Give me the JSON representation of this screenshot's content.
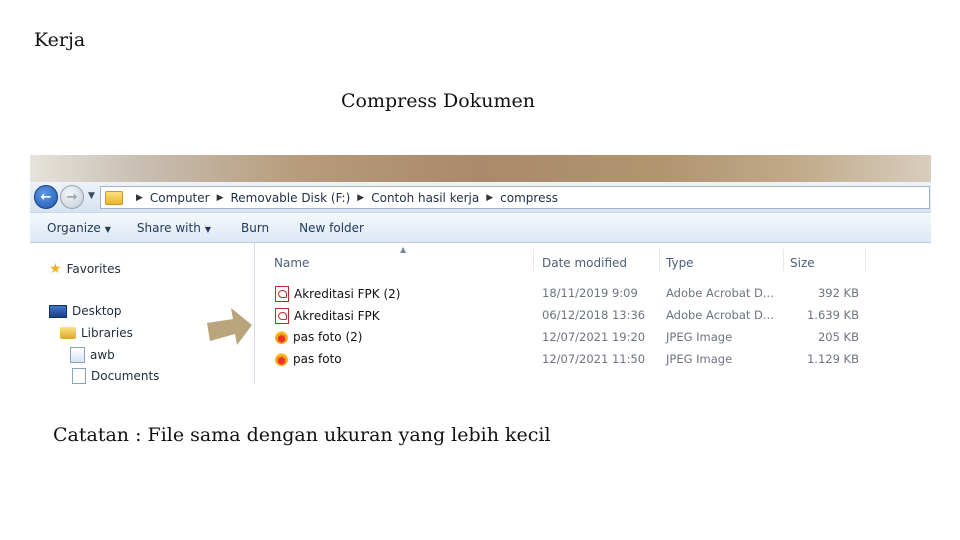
{
  "slide": {
    "heading": "Kerja",
    "title": "Compress Dokumen",
    "note": "Catatan : File sama dengan ukuran yang lebih kecil"
  },
  "explorer": {
    "breadcrumb": [
      "Computer",
      "Removable Disk (F:)",
      "Contoh hasil kerja",
      "compress"
    ],
    "toolbar": {
      "organize": "Organize",
      "share_with": "Share with",
      "burn": "Burn",
      "new_folder": "New folder"
    },
    "nav": {
      "favorites": "Favorites",
      "desktop": "Desktop",
      "libraries": "Libraries",
      "awb": "awb",
      "documents": "Documents"
    },
    "columns": {
      "name": "Name",
      "date": "Date modified",
      "type": "Type",
      "size": "Size"
    },
    "files": [
      {
        "name": "Akreditasi FPK (2)",
        "date": "18/11/2019 9:09",
        "type": "Adobe Acrobat D...",
        "size": "392 KB",
        "icon": "pdf-icon"
      },
      {
        "name": "Akreditasi FPK",
        "date": "06/12/2018 13:36",
        "type": "Adobe Acrobat D...",
        "size": "1.639 KB",
        "icon": "pdf-icon"
      },
      {
        "name": "pas foto (2)",
        "date": "12/07/2021 19:20",
        "type": "JPEG Image",
        "size": "205 KB",
        "icon": "jpeg-icon"
      },
      {
        "name": "pas foto",
        "date": "12/07/2021 11:50",
        "type": "JPEG Image",
        "size": "1.129 KB",
        "icon": "jpeg-icon"
      }
    ]
  },
  "colors": {
    "arrow": "#b9a47c",
    "toolbar_text": "#1e395b"
  }
}
